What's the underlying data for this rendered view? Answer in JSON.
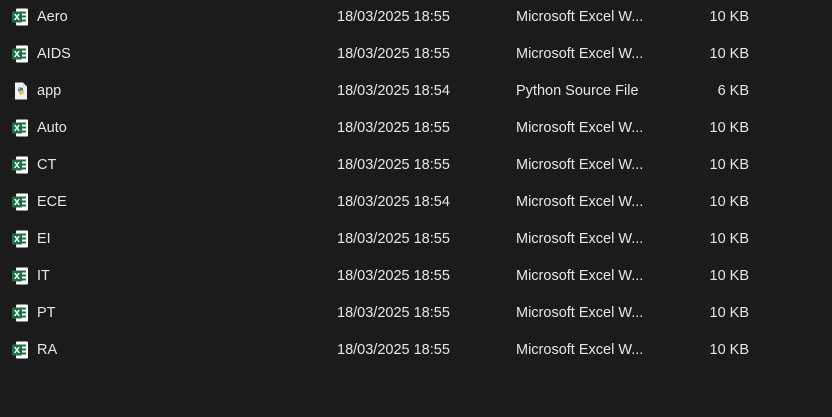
{
  "files": [
    {
      "name": "Aero",
      "date": "18/03/2025 18:55",
      "type": "Microsoft Excel W...",
      "size": "10 KB",
      "icon": "excel-icon"
    },
    {
      "name": "AIDS",
      "date": "18/03/2025 18:55",
      "type": "Microsoft Excel W...",
      "size": "10 KB",
      "icon": "excel-icon"
    },
    {
      "name": "app",
      "date": "18/03/2025 18:54",
      "type": "Python Source File",
      "size": "6 KB",
      "icon": "python-icon"
    },
    {
      "name": "Auto",
      "date": "18/03/2025 18:55",
      "type": "Microsoft Excel W...",
      "size": "10 KB",
      "icon": "excel-icon"
    },
    {
      "name": "CT",
      "date": "18/03/2025 18:55",
      "type": "Microsoft Excel W...",
      "size": "10 KB",
      "icon": "excel-icon"
    },
    {
      "name": "ECE",
      "date": "18/03/2025 18:54",
      "type": "Microsoft Excel W...",
      "size": "10 KB",
      "icon": "excel-icon"
    },
    {
      "name": "EI",
      "date": "18/03/2025 18:55",
      "type": "Microsoft Excel W...",
      "size": "10 KB",
      "icon": "excel-icon"
    },
    {
      "name": "IT",
      "date": "18/03/2025 18:55",
      "type": "Microsoft Excel W...",
      "size": "10 KB",
      "icon": "excel-icon"
    },
    {
      "name": "PT",
      "date": "18/03/2025 18:55",
      "type": "Microsoft Excel W...",
      "size": "10 KB",
      "icon": "excel-icon"
    },
    {
      "name": "RA",
      "date": "18/03/2025 18:55",
      "type": "Microsoft Excel W...",
      "size": "10 KB",
      "icon": "excel-icon"
    }
  ]
}
